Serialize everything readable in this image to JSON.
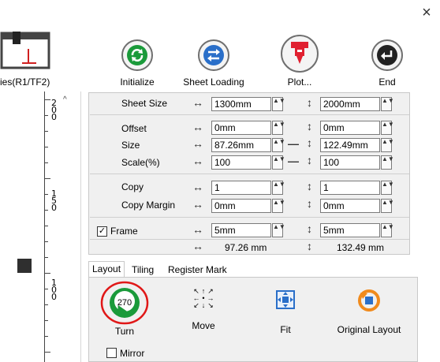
{
  "window": {
    "close_glyph": "×"
  },
  "preview": {
    "caption": "ies(R1/TF2)"
  },
  "ruler": {
    "labels": [
      {
        "lines": [
          "2",
          "0",
          "0"
        ]
      },
      {
        "lines": [
          "1",
          "5",
          "0"
        ]
      },
      {
        "lines": [
          "1",
          "0",
          "0"
        ]
      }
    ],
    "scroll_glyph": "^"
  },
  "toolbar": {
    "initialize": {
      "label": "Initialize",
      "icon": "refresh-icon"
    },
    "sheet_loading": {
      "label": "Sheet Loading",
      "icon": "swap-arrows-icon"
    },
    "plot": {
      "label": "Plot...",
      "icon": "cutter-icon"
    },
    "end": {
      "label": "End",
      "icon": "return-arrow-icon"
    }
  },
  "settings": {
    "horiz_glyph": "↔",
    "vert_glyph": "↕",
    "link_glyph": "—",
    "spin_glyph": "▲▼",
    "sheet_size": {
      "label": "Sheet Size",
      "w": "1300mm",
      "h": "2000mm"
    },
    "offset": {
      "label": "Offset",
      "w": "0mm",
      "h": "0mm"
    },
    "size": {
      "label": "Size",
      "w": "87.26mm",
      "h": "122.49mm"
    },
    "scale": {
      "label": "Scale(%)",
      "w": "100",
      "h": "100"
    },
    "copy": {
      "label": "Copy",
      "w": "1",
      "h": "1"
    },
    "copy_margin": {
      "label": "Copy Margin",
      "w": "0mm",
      "h": "0mm"
    },
    "frame": {
      "label": "Frame",
      "checked": true,
      "check_glyph": "✓",
      "w": "5mm",
      "h": "5mm"
    },
    "total": {
      "w": "97.26 mm",
      "h": "132.49 mm"
    }
  },
  "tabs": [
    {
      "label": "Layout",
      "active": true
    },
    {
      "label": "Tiling",
      "active": false
    },
    {
      "label": "Register Mark",
      "active": false
    }
  ],
  "layout": {
    "turn": {
      "label": "Turn",
      "badge": "270"
    },
    "move": {
      "label": "Move",
      "arrows": [
        "↖",
        "↑",
        "↗",
        "←",
        "•",
        "→",
        "↙",
        "↓",
        "↘"
      ]
    },
    "fit": {
      "label": "Fit"
    },
    "original": {
      "label": "Original Layout"
    },
    "mirror": {
      "label": "Mirror",
      "checked": false
    }
  },
  "colors": {
    "green": "#1a9a3a",
    "blue": "#2a6fc9",
    "red": "#e02030",
    "orange": "#f08a1c",
    "highlight_ring": "#e01818"
  }
}
